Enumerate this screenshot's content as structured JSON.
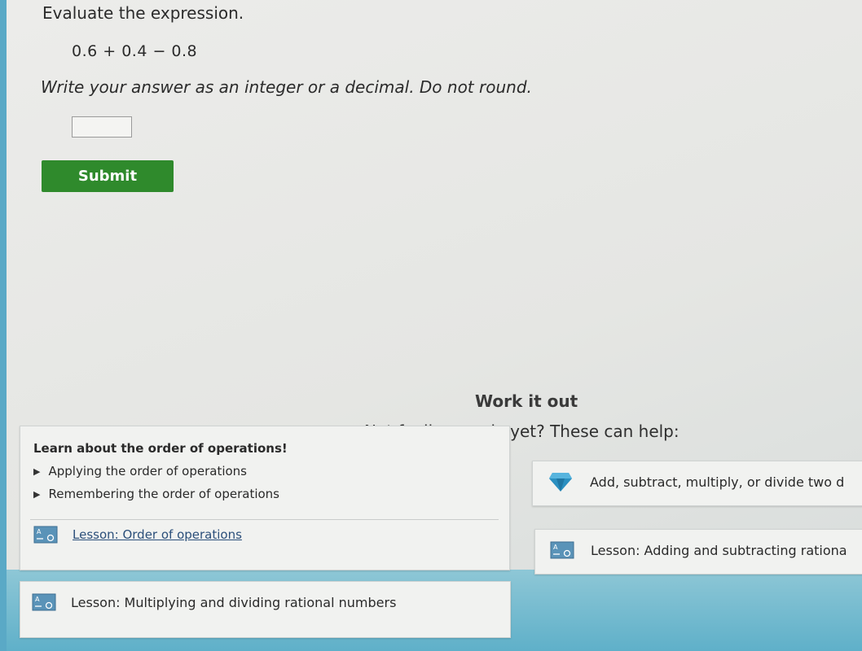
{
  "question": {
    "title": "Evaluate the expression.",
    "expression": "0.6 + 0.4 − 0.8",
    "instruction": "Write your answer as an integer or a decimal. Do not round.",
    "answer_value": "",
    "submit_label": "Submit"
  },
  "help": {
    "work_it_out": "Work it out",
    "not_ready": "Not feeling ready yet? These can help:",
    "card1": {
      "title": "Learn about the order of operations!",
      "items": [
        "Applying the order of operations",
        "Remembering the order of operations"
      ],
      "lesson": "Lesson: Order of operations"
    },
    "card2": {
      "text": "Add, subtract, multiply, or divide two d"
    },
    "card3": {
      "text": "Lesson: Adding and subtracting rationa"
    },
    "card4": {
      "text": "Lesson: Multiplying and dividing rational numbers"
    }
  },
  "colors": {
    "submit": "#2f8a2c",
    "accent_cyan": "#5fb0c9",
    "gem": "#2a8fc0"
  },
  "icons": [
    "lesson-board-icon",
    "diamond-gem-icon",
    "triangle-bullet-icon"
  ]
}
